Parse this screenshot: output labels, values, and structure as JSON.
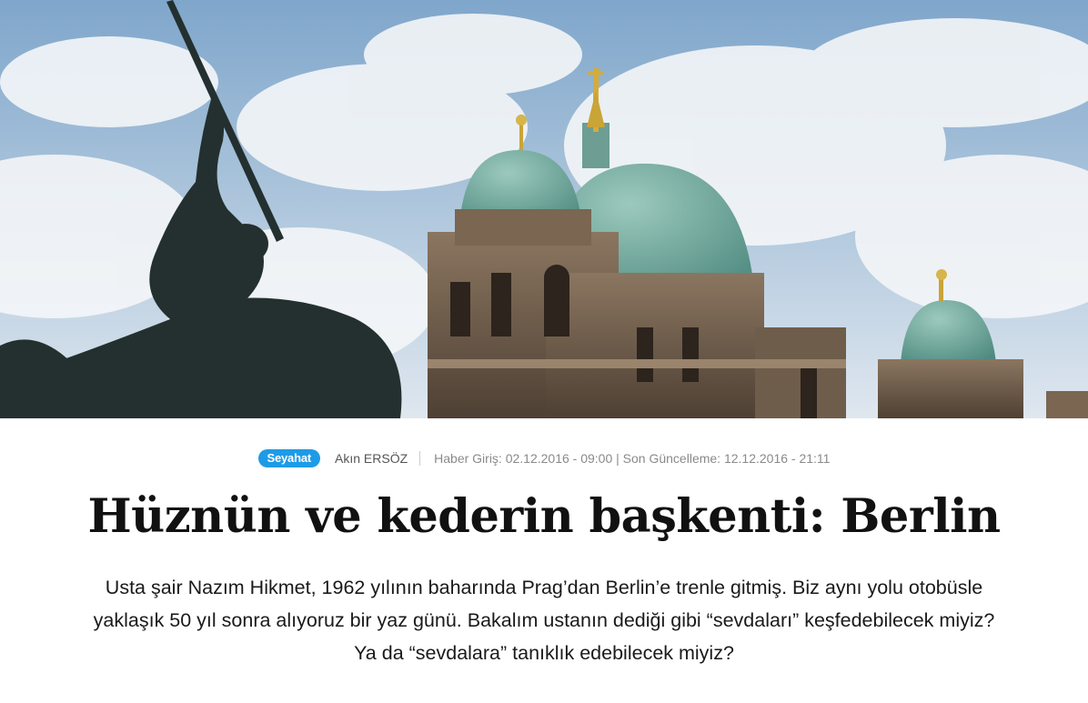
{
  "hero": {
    "image_name": "berlin-cathedral-hero-photo",
    "colors": {
      "sky": "#a9c3dc",
      "dome": "#6aa59a",
      "stone": "#6b5a48",
      "statue": "#2b3436"
    }
  },
  "article": {
    "category": "Seyahat",
    "category_color": "#1e9be6",
    "author": "Akın ERSÖZ",
    "dates": "Haber Giriş: 02.12.2016 - 09:00 | Son Güncelleme: 12.12.2016 - 21:11",
    "title": "Hüznün ve kederin başkenti: Berlin",
    "lead": "Usta şair Nazım Hikmet, 1962 yılının baharında Prag’dan Berlin’e trenle gitmiş. Biz aynı yolu otobüsle yaklaşık 50 yıl sonra alıyoruz bir yaz günü. Bakalım ustanın dediği gibi “sevdaları” keşfedebilecek miyiz? Ya da “sevdalara” tanıklık edebilecek miyiz?"
  }
}
